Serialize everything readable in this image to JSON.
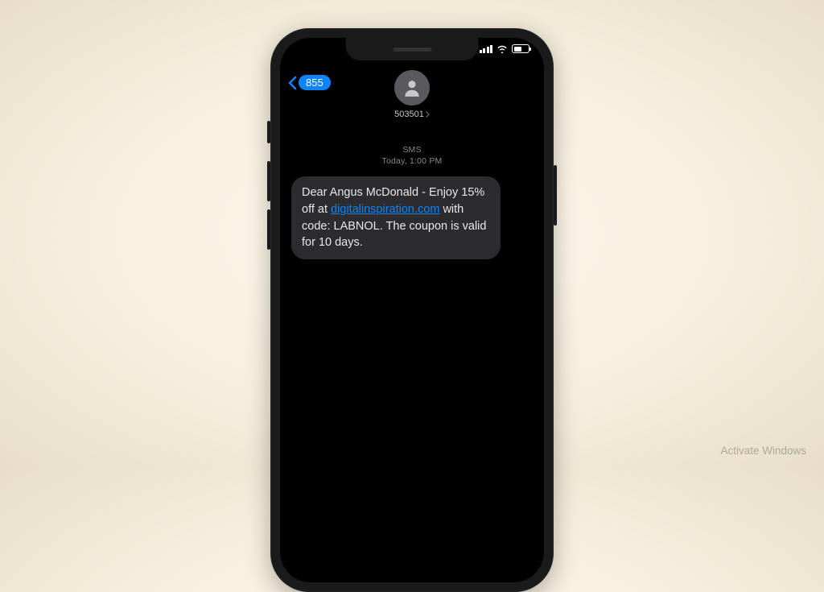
{
  "back": {
    "badge": "855"
  },
  "contact": {
    "sender": "503501"
  },
  "meta": {
    "channel": "SMS",
    "timestamp": "Today, 1:00 PM"
  },
  "message": {
    "part1": "Dear Angus McDonald - Enjoy 15% off at ",
    "link": "digitalinspiration.com",
    "part2": " with code: LABNOL. The coupon is valid for 10 days."
  },
  "watermark": "Activate Windows"
}
